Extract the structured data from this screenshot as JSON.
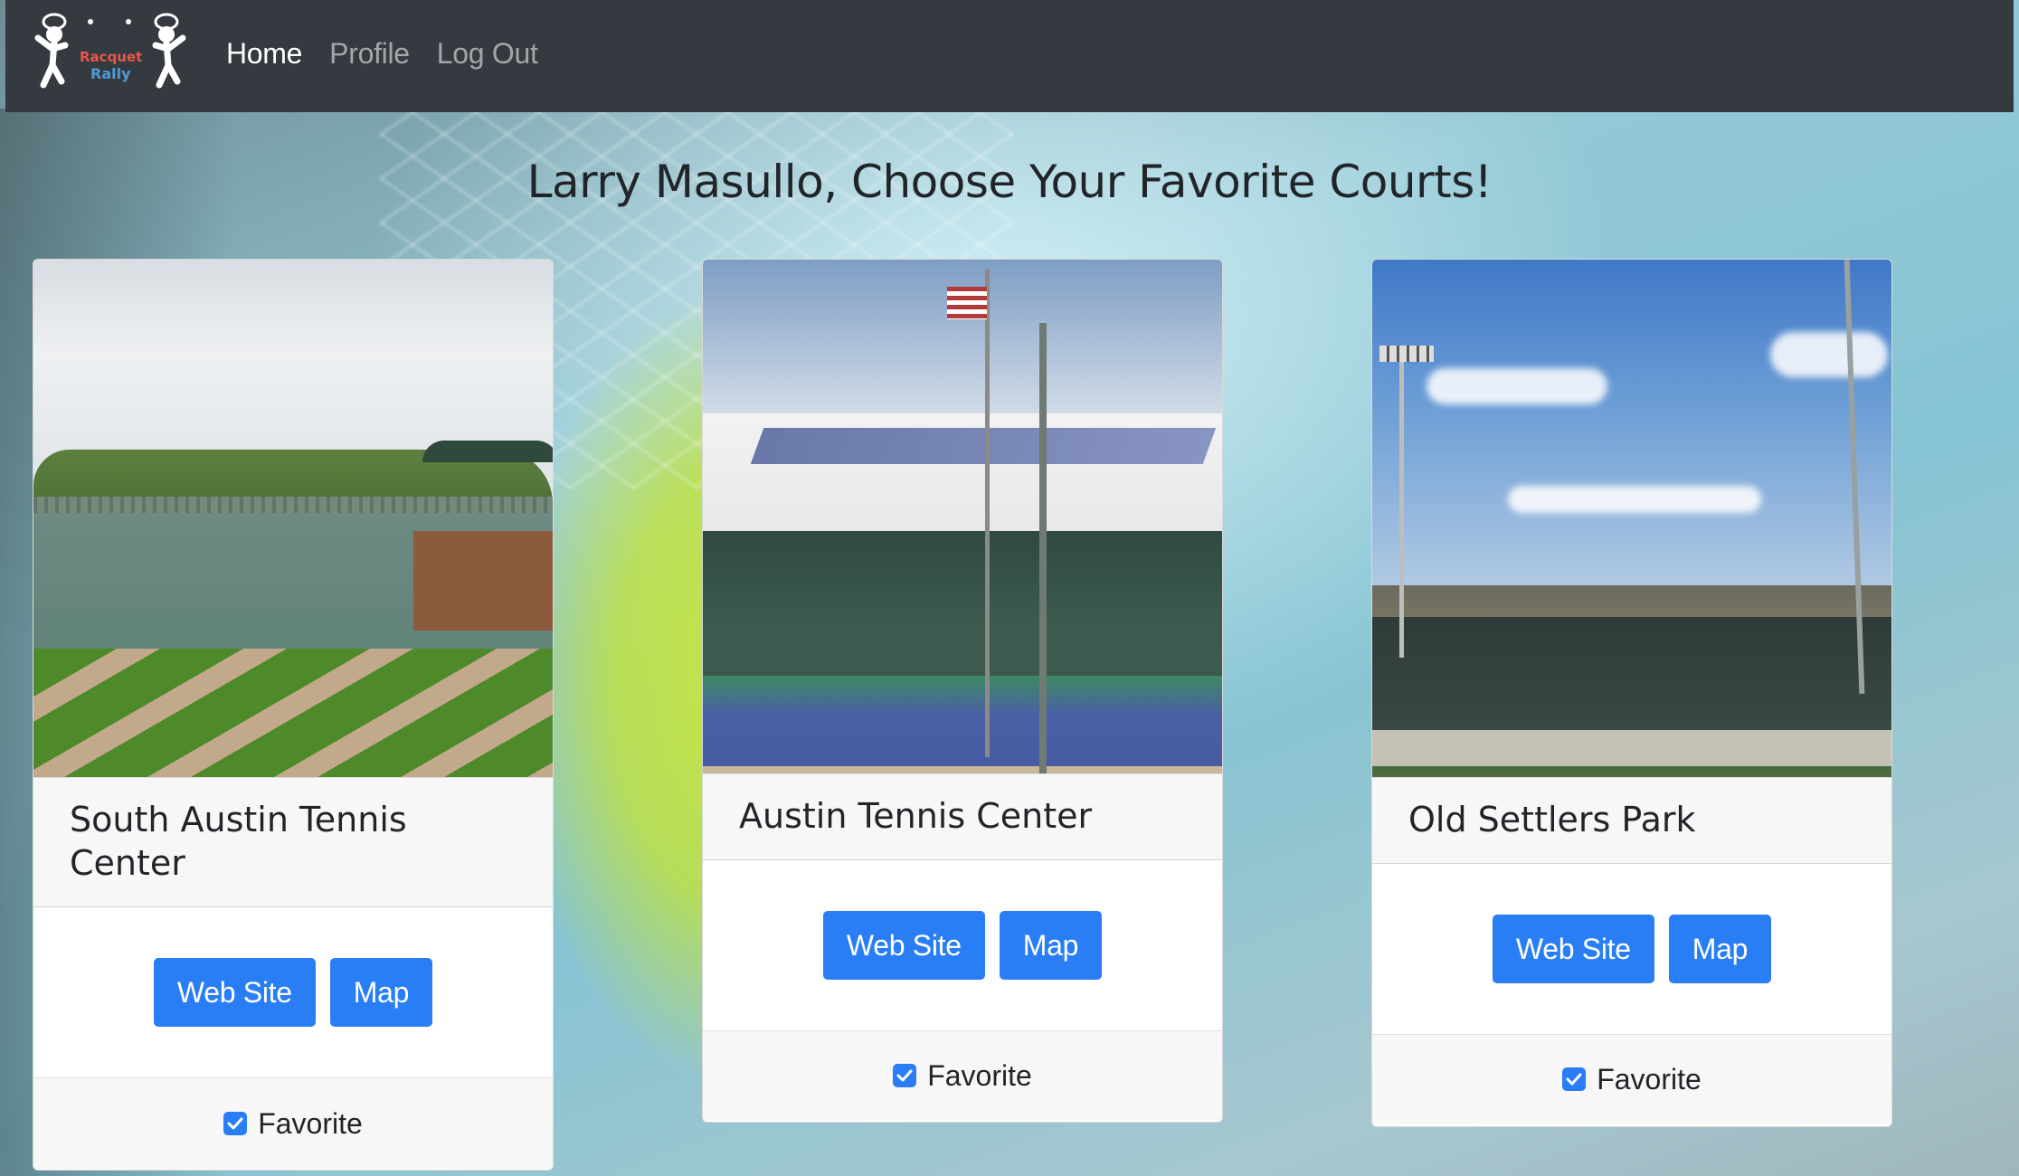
{
  "brand": {
    "line1": "Racquet",
    "line2": "Rally"
  },
  "nav": {
    "items": [
      {
        "label": "Home",
        "active": true
      },
      {
        "label": "Profile",
        "active": false
      },
      {
        "label": "Log Out",
        "active": false
      }
    ]
  },
  "page": {
    "title": "Larry Masullo, Choose Your Favorite Courts!"
  },
  "colors": {
    "navbar": "#343a40",
    "primary_button": "#2a7ef5",
    "checkbox": "#2a7ef5"
  },
  "courts": [
    {
      "name": "South Austin Tennis Center",
      "website_label": "Web Site",
      "map_label": "Map",
      "favorite_label": "Favorite",
      "favorite_checked": true
    },
    {
      "name": "Austin Tennis Center",
      "website_label": "Web Site",
      "map_label": "Map",
      "favorite_label": "Favorite",
      "favorite_checked": true
    },
    {
      "name": "Old Settlers Park",
      "website_label": "Web Site",
      "map_label": "Map",
      "favorite_label": "Favorite",
      "favorite_checked": true
    }
  ]
}
